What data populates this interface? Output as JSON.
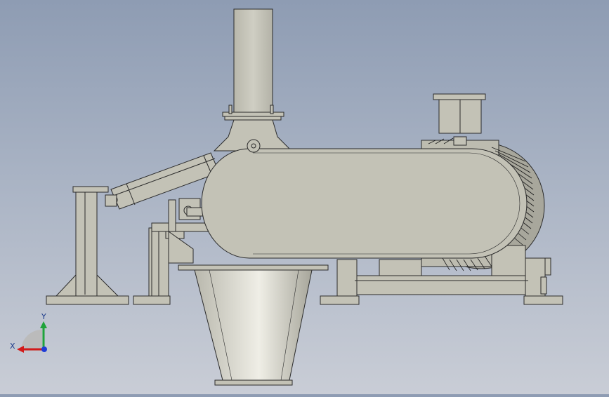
{
  "viewport": {
    "background_top": "#8e9cb3",
    "background_bottom": "#c9cdd6",
    "part_fill": "#c3c2b6",
    "part_edge": "#2b2b2b"
  },
  "triad": {
    "x_label": "X",
    "y_label": "Y",
    "x_color": "#d21a1a",
    "y_color": "#1fa33a",
    "z_color": "#1f3cd6"
  }
}
